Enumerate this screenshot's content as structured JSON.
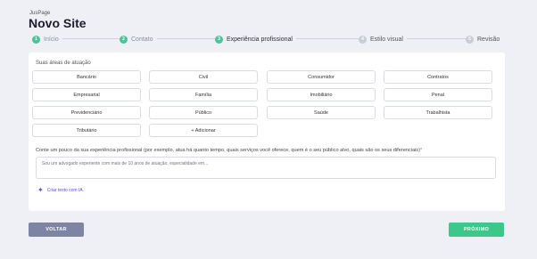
{
  "header": {
    "brand": "JusPage",
    "title": "Novo Site"
  },
  "stepper": {
    "steps": [
      {
        "number": "1",
        "label": "Início",
        "state": "done"
      },
      {
        "number": "2",
        "label": "Contato",
        "state": "done"
      },
      {
        "number": "3",
        "label": "Experiência profissional",
        "state": "active"
      },
      {
        "number": "4",
        "label": "Estilo visual",
        "state": "todo"
      },
      {
        "number": "5",
        "label": "Revisão",
        "state": "todo"
      }
    ]
  },
  "form": {
    "areas_label": "Suas áreas de atuação",
    "areas": [
      "Bancário",
      "Civil",
      "Consumidor",
      "Contratos",
      "Empresarial",
      "Família",
      "Imobiliário",
      "Penal",
      "Previdenciário",
      "Público",
      "Saúde",
      "Trabalhista",
      "Tributário",
      "+ Adicionar"
    ],
    "experience_label": "Conte um pouco da sua experiência profissional (por exemplo, atua há quanto tempo, quais serviços você oferece, quem é o seu público alvo, quais são os seus diferenciais)",
    "experience_required_mark": "*",
    "experience_placeholder": "Sou um advogado experiente com mais de 10 anos de atuação, especialidade em...",
    "experience_value": "",
    "ai_link": "Criar texto com IA"
  },
  "actions": {
    "back_label": "VOLTAR",
    "next_label": "PRÓXIMO"
  },
  "colors": {
    "accent_green": "#3ec78b",
    "back_button": "#7d85a2",
    "ai_purple": "#5a4fcf",
    "background": "#eef0f6"
  }
}
